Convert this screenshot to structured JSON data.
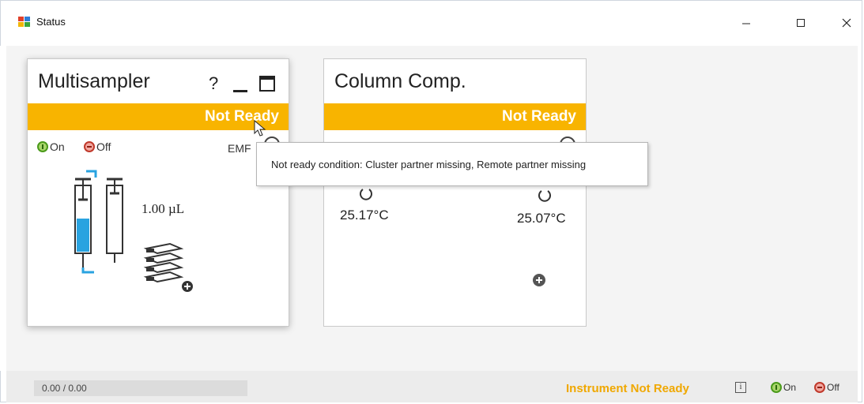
{
  "window": {
    "title": "Status"
  },
  "multisampler": {
    "title": "Multisampler",
    "help": "?",
    "status": "Not Ready",
    "on_label": "On",
    "off_label": "Off",
    "emf_label": "EMF",
    "volume": "1.00 µL"
  },
  "column_comp": {
    "title": "Column Comp.",
    "status": "Not Ready",
    "temp_left": "25.17°C",
    "temp_right": "25.07°C"
  },
  "tooltip": {
    "text": "Not ready condition: Cluster partner missing, Remote partner missing"
  },
  "footer": {
    "progress_text": "0.00 / 0.00",
    "instrument_status": "Instrument Not Ready",
    "info_glyph": "i",
    "on_label": "On",
    "off_label": "Off"
  },
  "colors": {
    "accent": "#f8b400",
    "sampler_blue": "#29a3e0",
    "on_green": "#4a9a1a",
    "off_red": "#c0392b"
  }
}
